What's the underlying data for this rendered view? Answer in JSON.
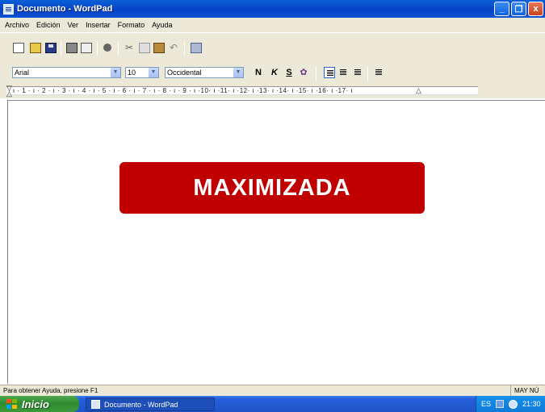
{
  "window": {
    "title": "Documento - WordPad",
    "minimize_label": "_",
    "maximize_label": "❐",
    "close_label": "x"
  },
  "menu": {
    "items": [
      "Archivo",
      "Edición",
      "Ver",
      "Insertar",
      "Formato",
      "Ayuda"
    ]
  },
  "toolbar": {
    "icons": [
      "new-document-icon",
      "open-icon",
      "save-icon",
      "print-icon",
      "print-preview-icon",
      "find-icon",
      "cut-icon",
      "copy-icon",
      "paste-icon",
      "undo-icon",
      "insert-date-icon"
    ]
  },
  "format_bar": {
    "font": "Arial",
    "size": "10",
    "script": "Occidental",
    "bold": "N",
    "italic": "K",
    "underline": "S",
    "color_icon": "color-palette-icon",
    "align_left_pressed": true
  },
  "ruler": {
    "text": "· ı · 1 · ı · 2 · ı · 3 · ı · 4 · ı · 5 · ı · 6 · ı · 7 · ı · 8 · ı · 9 · ı ·10· ı ·11· ı ·12· ı ·13· ı ·14· ı ·15· ı ·16· ı ·17· ı"
  },
  "document": {
    "banner_text": "MAXIMIZADA",
    "banner_color": "#c00000"
  },
  "status": {
    "help_text": "Para obtener Ayuda, presione F1",
    "indicator": "MAY  NÚ"
  },
  "taskbar": {
    "start_label": "Inicio",
    "task_label": "Documento - WordPad",
    "language": "ES",
    "clock": "21:30"
  }
}
